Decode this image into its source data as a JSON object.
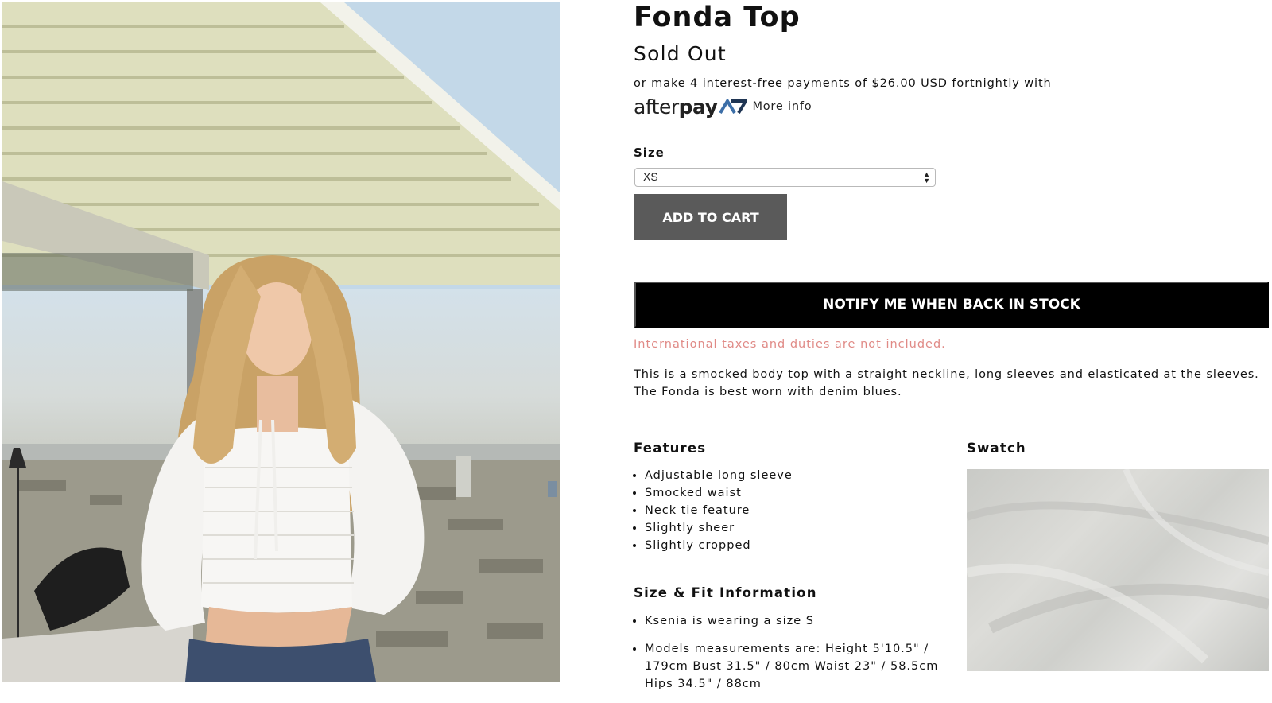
{
  "product": {
    "title": "Fonda Top",
    "status": "Sold Out"
  },
  "afterpay": {
    "text": "or make 4 interest-free payments of $26.00 USD fortnightly with",
    "logo_after": "after",
    "logo_pay": "pay",
    "more_info_label": "More info"
  },
  "size_selector": {
    "label": "Size",
    "selected": "XS"
  },
  "buttons": {
    "add_to_cart": "ADD TO CART",
    "notify": "NOTIFY ME WHEN BACK IN STOCK"
  },
  "tax_note": "International taxes and duties are not included.",
  "description": "This is a smocked body top with a straight neckline, long sleeves and elasticated at the sleeves. The Fonda is best worn with denim blues.",
  "features": {
    "heading": "Features",
    "items": [
      "Adjustable long sleeve",
      "Smocked waist",
      "Neck tie feature",
      "Slightly sheer",
      "Slightly cropped"
    ]
  },
  "swatch": {
    "heading": "Swatch"
  },
  "size_fit": {
    "heading": "Size & Fit Information",
    "items": [
      "Ksenia is wearing a size S",
      "Models measurements are: Height 5'10.5\" / 179cm Bust 31.5\" / 80cm Waist 23\" / 58.5cm Hips 34.5\" / 88cm"
    ]
  },
  "colors": {
    "notify_bg": "#000000",
    "add_to_cart_bg": "#5a5a5a",
    "tax_note": "#e08a86",
    "afterpay_mark": "#3d6fa8"
  }
}
